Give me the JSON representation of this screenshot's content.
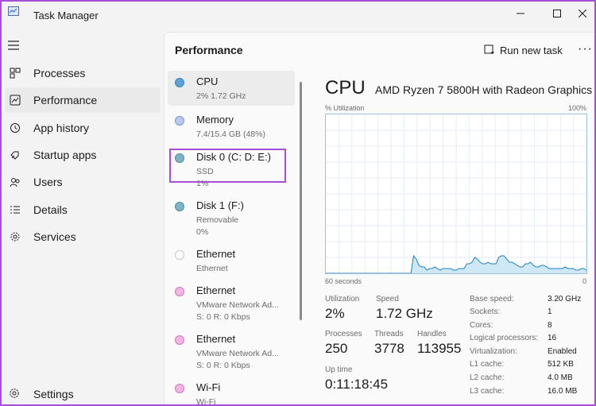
{
  "app": {
    "title": "Task Manager"
  },
  "nav": [
    {
      "label": "Processes",
      "icon": "processes-icon"
    },
    {
      "label": "Performance",
      "icon": "performance-icon",
      "active": true
    },
    {
      "label": "App history",
      "icon": "history-icon"
    },
    {
      "label": "Startup apps",
      "icon": "startup-icon"
    },
    {
      "label": "Users",
      "icon": "users-icon"
    },
    {
      "label": "Details",
      "icon": "details-icon"
    },
    {
      "label": "Services",
      "icon": "services-icon"
    }
  ],
  "settings": {
    "label": "Settings"
  },
  "header": {
    "title": "Performance",
    "run_task_label": "Run new task",
    "more_label": "···"
  },
  "devices": [
    {
      "name": "CPU",
      "sub": [
        "2%  1.72 GHz"
      ],
      "color": "#5ba3d9",
      "selected": true
    },
    {
      "name": "Memory",
      "sub": [
        "7.4/15.4 GB (48%)"
      ],
      "color": "#b8c8ee"
    },
    {
      "name": "Disk 0 (C: D: E:)",
      "sub": [
        "SSD",
        "1%"
      ],
      "color": "#7fb3c8"
    },
    {
      "name": "Disk 1 (F:)",
      "sub": [
        "Removable",
        "0%"
      ],
      "color": "#7fb3c8"
    },
    {
      "name": "Ethernet",
      "sub": [
        "Ethernet"
      ],
      "color": "#ffffff"
    },
    {
      "name": "Ethernet",
      "sub": [
        "VMware Network Ad...",
        "S: 0  R: 0 Kbps"
      ],
      "color": "#e9a0d8"
    },
    {
      "name": "Ethernet",
      "sub": [
        "VMware Network Ad...",
        "S: 0  R: 0 Kbps"
      ],
      "color": "#e9a0d8"
    },
    {
      "name": "Wi-Fi",
      "sub": [
        "Wi-Fi"
      ],
      "color": "#e9a0d8"
    }
  ],
  "detail": {
    "title": "CPU",
    "model": "AMD Ryzen 7 5800H with Radeon Graphics",
    "util_label": "% Utilization",
    "util_max": "100%",
    "time_left": "60 seconds",
    "time_right": "0",
    "utilization_label": "Utilization",
    "utilization_value": "2%",
    "speed_label": "Speed",
    "speed_value": "1.72 GHz",
    "processes_label": "Processes",
    "processes_value": "250",
    "threads_label": "Threads",
    "threads_value": "3778",
    "handles_label": "Handles",
    "handles_value": "113955",
    "uptime_label": "Up time",
    "uptime_value": "0:11:18:45",
    "specs": [
      {
        "label": "Base speed:",
        "value": "3.20 GHz"
      },
      {
        "label": "Sockets:",
        "value": "1"
      },
      {
        "label": "Cores:",
        "value": "8"
      },
      {
        "label": "Logical processors:",
        "value": "16"
      },
      {
        "label": "Virtualization:",
        "value": "Enabled"
      },
      {
        "label": "L1 cache:",
        "value": "512 KB"
      },
      {
        "label": "L2 cache:",
        "value": "4.0 MB"
      },
      {
        "label": "L3 cache:",
        "value": "16.0 MB"
      }
    ],
    "graph_values": [
      0,
      0,
      0,
      0,
      0,
      0,
      0,
      0,
      0,
      0,
      0,
      0,
      0,
      0,
      0,
      0,
      0,
      0,
      0,
      0,
      0,
      0,
      0,
      0,
      0,
      0,
      0,
      0,
      0,
      0,
      0,
      0,
      0,
      11,
      9,
      5,
      4,
      4,
      2,
      3,
      3,
      4,
      3,
      2,
      3,
      3,
      3,
      3,
      2,
      2,
      3,
      3,
      3,
      6,
      6,
      7,
      10,
      9,
      7,
      6,
      6,
      7,
      6,
      6,
      6,
      10,
      11,
      11,
      9,
      7,
      7,
      6,
      5,
      4,
      4,
      6,
      6,
      7,
      5,
      4,
      4,
      5,
      5,
      4,
      3,
      3,
      3,
      3,
      3,
      3,
      4,
      3,
      3,
      3,
      2,
      2,
      3,
      3,
      2
    ],
    "graph_color": "#1c80c8",
    "graph_fill": "#cfe8f5"
  }
}
